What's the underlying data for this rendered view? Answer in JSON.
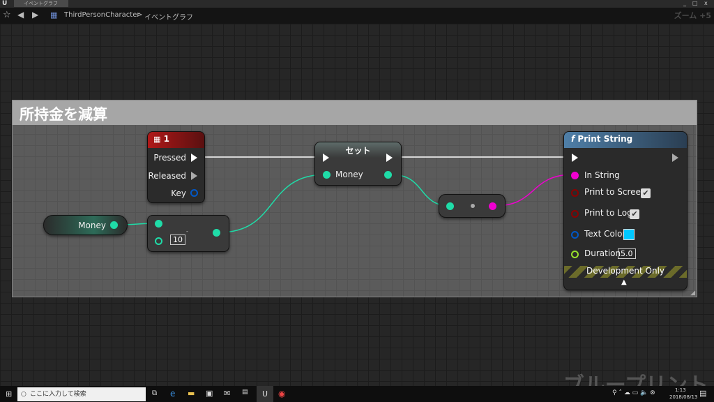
{
  "window": {
    "tab_title": "イベントグラフ",
    "tab_close": "×",
    "min": "_",
    "max": "□",
    "close": "x"
  },
  "toolbar": {
    "breadcrumb_root": "ThirdPersonCharacter",
    "breadcrumb_sep": ">",
    "breadcrumb_current": "イベントグラフ",
    "zoom": "ズーム +5"
  },
  "comment": {
    "title": "所持金を減算"
  },
  "nodes": {
    "input_event": {
      "title": "1",
      "pins": [
        "Pressed",
        "Released",
        "Key"
      ]
    },
    "get_money": {
      "label": "Money"
    },
    "subtract": {
      "operator": "-",
      "value": "10"
    },
    "set": {
      "title": "セット",
      "pin": "Money"
    },
    "print_string": {
      "title": "Print String",
      "func_icon": "f",
      "pins": [
        "In String",
        "Print to Screen",
        "Print to Log",
        "Text Color",
        "Duration"
      ],
      "duration": "5.0",
      "print_to_screen": true,
      "print_to_log": true,
      "text_color": "#00c8ff",
      "footer": "Development Only"
    }
  },
  "watermark": "ブループリント",
  "taskbar": {
    "search_placeholder": "ここに入力して検索",
    "time": "1:13",
    "date": "2018/08/13"
  },
  "colors": {
    "exec": "#ffffff",
    "int": "#1fdca8",
    "string": "#f000d0",
    "bool": "#8b0000",
    "struct": "#0058c8",
    "float": "#9ae02c"
  }
}
